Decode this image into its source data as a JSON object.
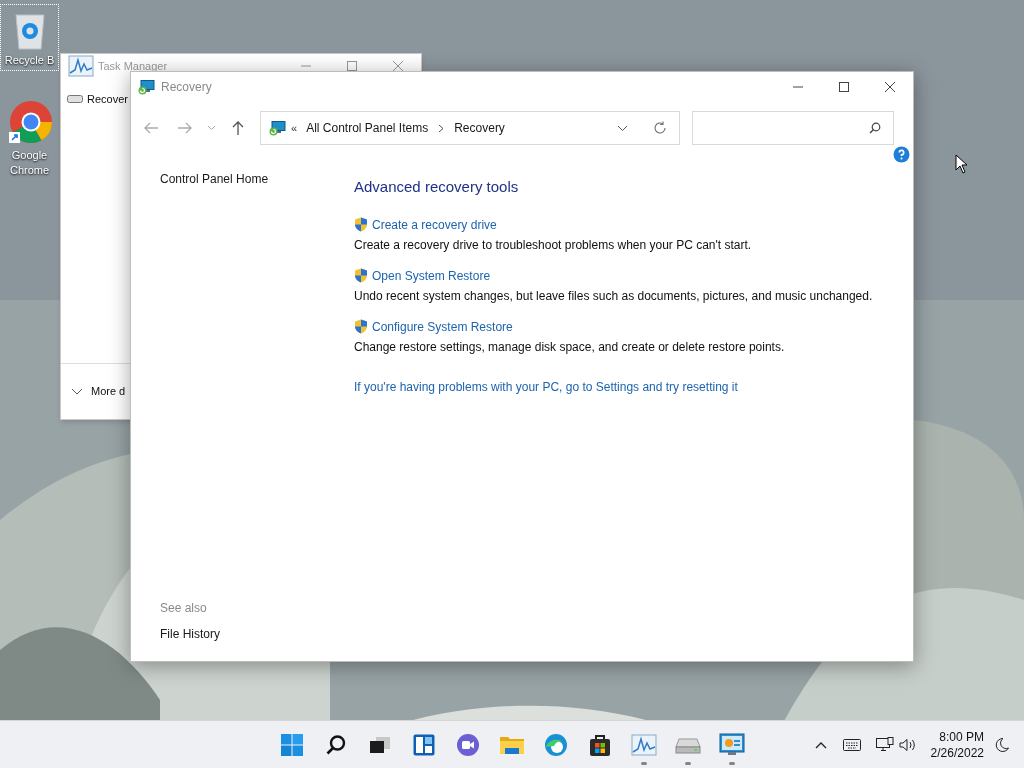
{
  "desktop_icons": [
    {
      "kind": "bin",
      "label": "Recycle B",
      "selected": true
    },
    {
      "kind": "chrome",
      "label": "Google Chrome",
      "selected": false
    }
  ],
  "task_manager": {
    "title": "Task Manager",
    "items": [
      "Recover"
    ],
    "footer": "More d"
  },
  "window": {
    "title": "Recovery",
    "breadcrumb": {
      "prefix": "«",
      "items": [
        "All Control Panel Items",
        "Recovery"
      ]
    },
    "sidebar": {
      "items": [
        "Control Panel Home"
      ],
      "see_also_heading": "See also",
      "see_also": [
        "File History"
      ]
    },
    "content": {
      "heading": "Advanced recovery tools",
      "tasks": [
        {
          "link": "Create a recovery drive",
          "description": "Create a recovery drive to troubleshoot problems when your PC can't start."
        },
        {
          "link": "Open System Restore",
          "description": "Undo recent system changes, but leave files such as documents, pictures, and music unchanged."
        },
        {
          "link": "Configure System Restore",
          "description": "Change restore settings, manage disk space, and create or delete restore points."
        }
      ],
      "footer_link": "If you're having problems with your PC, go to Settings and try resetting it"
    }
  },
  "taskbar": {
    "apps": [
      {
        "kind": "start",
        "running": false
      },
      {
        "kind": "search",
        "running": false
      },
      {
        "kind": "taskview",
        "running": false
      },
      {
        "kind": "widgets",
        "running": false
      },
      {
        "kind": "chat",
        "running": false
      },
      {
        "kind": "explorer",
        "running": false
      },
      {
        "kind": "edge",
        "running": false
      },
      {
        "kind": "store",
        "running": false
      },
      {
        "kind": "taskmanager",
        "running": true
      },
      {
        "kind": "drive",
        "running": true
      },
      {
        "kind": "controlpanel",
        "running": true
      }
    ],
    "time": "8:00 PM",
    "date": "2/26/2022"
  }
}
